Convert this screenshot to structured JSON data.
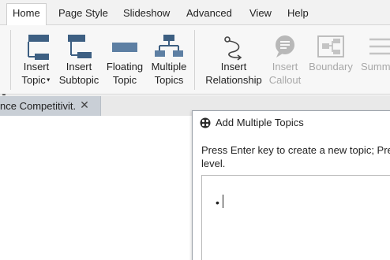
{
  "menubar": {
    "items": [
      "Home",
      "Page Style",
      "Slideshow",
      "Advanced",
      "View",
      "Help"
    ],
    "active": "Home"
  },
  "ribbon": {
    "buttons": [
      {
        "line1": "Insert",
        "line2": "Topic",
        "has_caret": true,
        "disabled": false,
        "icon": "insert-topic-icon"
      },
      {
        "line1": "Insert",
        "line2": "Subtopic",
        "disabled": false,
        "icon": "insert-subtopic-icon"
      },
      {
        "line1": "Floating",
        "line2": "Topic",
        "disabled": false,
        "icon": "floating-topic-icon"
      },
      {
        "line1": "Multiple",
        "line2": "Topics",
        "disabled": false,
        "icon": "multiple-topics-icon"
      },
      {
        "line1": "Insert",
        "line2": "Relationship",
        "disabled": false,
        "icon": "relationship-icon"
      },
      {
        "line1": "Insert",
        "line2": "Callout",
        "disabled": true,
        "icon": "callout-icon"
      },
      {
        "line1": "Boundary",
        "line2": "",
        "disabled": true,
        "icon": "boundary-icon"
      },
      {
        "line1": "Summ",
        "line2": "",
        "disabled": true,
        "icon": "summary-icon"
      }
    ]
  },
  "doc_tab": {
    "label": "nce Competitivit...",
    "close": "✕"
  },
  "dialog": {
    "title": "Add Multiple Topics",
    "instruction": "Press Enter key to create a new topic; Pre level.",
    "instruction_line1": "Press Enter key to create a new topic; Pre",
    "instruction_line2": "level.",
    "bullet": "•"
  },
  "colors": {
    "accent_blue": "#2f5f8a",
    "disabled_gray": "#a8a8a8",
    "tab_bg": "#c9cfd6"
  }
}
